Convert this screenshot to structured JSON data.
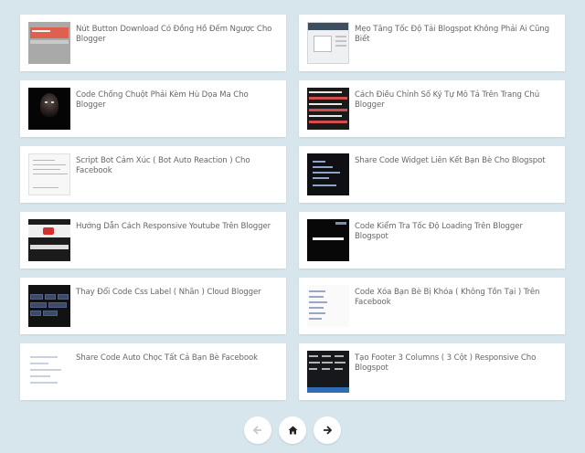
{
  "posts": [
    {
      "title": "Nút Button Download Có Đồng Hồ Đếm Ngược Cho Blogger",
      "thumb_icon": "countdown-thumbnail"
    },
    {
      "title": "Mẹo Tăng Tốc Độ Tải Blogspot Không Phải Ai Cũng Biết",
      "thumb_icon": "speed-thumbnail"
    },
    {
      "title": "Code Chống Chuột Phải Kèm Hù Dọa Ma Cho Blogger",
      "thumb_icon": "horror-face-thumbnail"
    },
    {
      "title": "Cách Điều Chỉnh Số Ký Tự Mô Tả Trên Trang Chủ Blogger",
      "thumb_icon": "character-count-thumbnail"
    },
    {
      "title": "Script Bot Cảm Xúc ( Bot Auto Reaction ) Cho Facebook",
      "thumb_icon": "bot-script-thumbnail"
    },
    {
      "title": "Share Code Widget Liên Kết Bạn Bè Cho Blogspot",
      "thumb_icon": "widget-thumbnail"
    },
    {
      "title": "Hướng Dẫn Cách Responsive Youtube Trên Blogger",
      "thumb_icon": "youtube-thumbnail"
    },
    {
      "title": "Code Kiểm Tra Tốc Độ Loading Trên Blogger Blogspot",
      "thumb_icon": "loading-thumbnail"
    },
    {
      "title": "Thay Đổi Code Css Label ( Nhãn ) Cloud Blogger",
      "thumb_icon": "label-cloud-thumbnail"
    },
    {
      "title": "Code Xóa Bạn Bè Bị Khóa ( Không Tồn Tại ) Trên Facebook",
      "thumb_icon": "friend-list-thumbnail"
    },
    {
      "title": "Share Code Auto Chọc Tất Cả Bạn Bè Facebook",
      "thumb_icon": "auto-poke-thumbnail"
    },
    {
      "title": "Tạo Footer 3 Columns ( 3 Cột ) Responsive Cho Blogspot",
      "thumb_icon": "footer-thumbnail"
    }
  ],
  "pagination": {
    "prev_icon": "arrow-left-icon",
    "home_icon": "home-icon",
    "next_icon": "arrow-right-icon"
  },
  "colors": {
    "background": "#d7e5ec",
    "card": "#ffffff",
    "title_text": "#666666"
  }
}
